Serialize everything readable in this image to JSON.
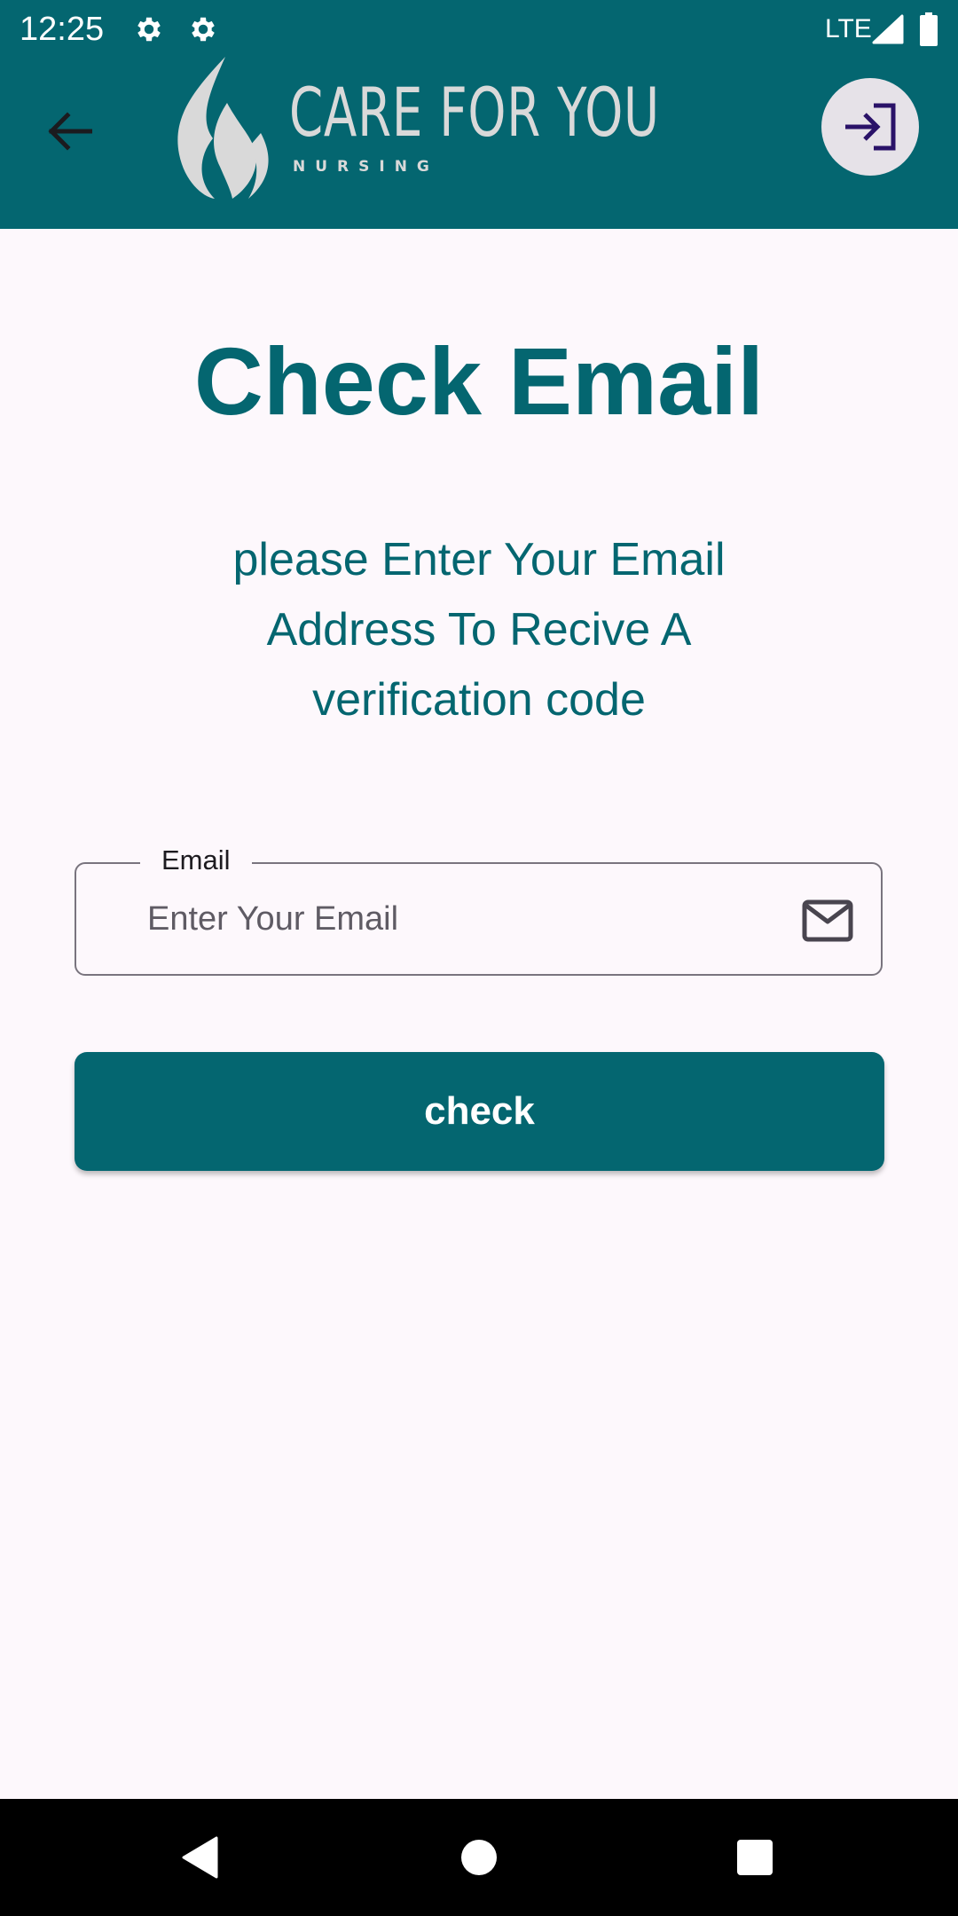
{
  "status_bar": {
    "time": "12:25",
    "network": "LTE",
    "icons": [
      "gear-icon",
      "gear-icon",
      "signal-icon",
      "battery-icon"
    ]
  },
  "app_bar": {
    "back_icon": "arrow-left-icon",
    "logo_title": "CARE FOR YOU",
    "logo_subtitle": "NURSING",
    "login_icon": "login-icon"
  },
  "main": {
    "title": "Check Email",
    "instructions": "please Enter Your Email Address To Recive A verification code",
    "email_field": {
      "label": "Email",
      "value": "",
      "placeholder": "Enter Your Email",
      "icon": "mail-icon"
    },
    "check_button_label": "check"
  },
  "nav_bar": {
    "icons": [
      "triangle-back-icon",
      "circle-home-icon",
      "square-recents-icon"
    ]
  },
  "colors": {
    "primary": "#046670",
    "background": "#fdf8fc",
    "logo": "#d9d9d9",
    "login_icon": "#2a1268",
    "outline": "#79747e"
  }
}
